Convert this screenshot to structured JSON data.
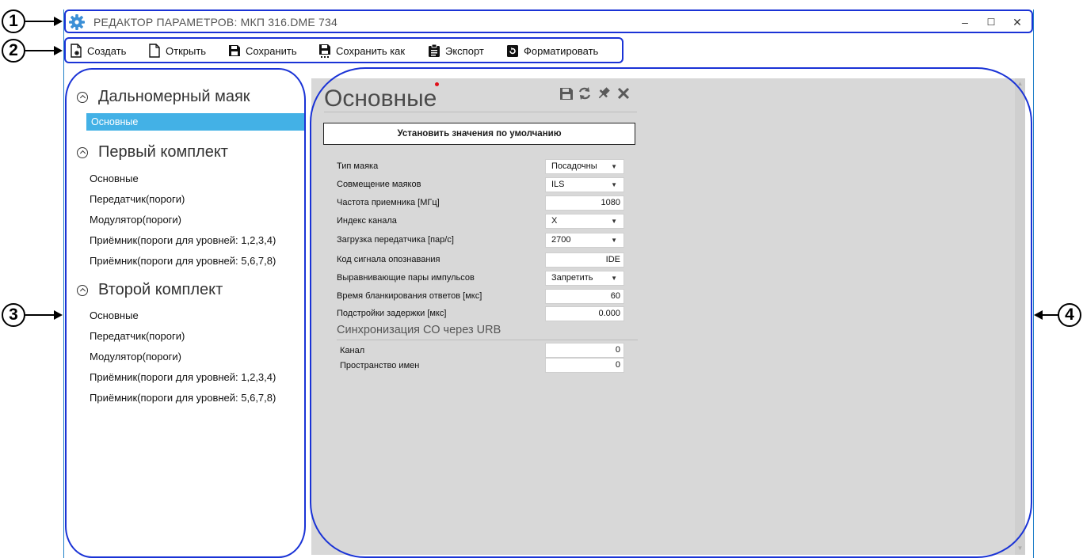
{
  "window": {
    "title": "РЕДАКТОР ПАРАМЕТРОВ: МКП 316.DME 734",
    "minimize": "–",
    "maximize": "☐",
    "close": "✕"
  },
  "toolbar": {
    "create": "Создать",
    "open": "Открыть",
    "save": "Сохранить",
    "save_as": "Сохранить как",
    "export": "Экспорт",
    "format": "Форматировать"
  },
  "nav": {
    "group1": {
      "title": "Дальномерный маяк",
      "items": [
        "Основные"
      ]
    },
    "group2": {
      "title": "Первый комплект",
      "items": [
        "Основные",
        "Передатчик(пороги)",
        "Модулятор(пороги)",
        "Приёмник(пороги для уровней: 1,2,3,4)",
        "Приёмник(пороги для уровней: 5,6,7,8)"
      ]
    },
    "group3": {
      "title": "Второй комплект",
      "items": [
        "Основные",
        "Передатчик(пороги)",
        "Модулятор(пороги)",
        "Приёмник(пороги для уровней: 1,2,3,4)",
        "Приёмник(пороги для уровней: 5,6,7,8)"
      ]
    },
    "selected_index": 0,
    "selected_color": "#43b1e6"
  },
  "panel": {
    "title": "Основные",
    "default_button": "Установить значения по умолчанию",
    "rows": [
      {
        "label": "Тип маяка",
        "value": "Посадочны",
        "type": "select"
      },
      {
        "label": "Совмещение маяков",
        "value": "ILS",
        "type": "select"
      },
      {
        "label": "Частота приемника  [МГц]",
        "value": "1080",
        "type": "input"
      },
      {
        "label": "Индекс канала",
        "value": "X",
        "type": "select"
      },
      {
        "label": "Загрузка передатчика  [пар/с]",
        "value": "2700",
        "type": "select"
      },
      {
        "label": "Код сигнала опознавания",
        "value": "IDE",
        "type": "input"
      },
      {
        "label": "Выравнивающие пары импульсов",
        "value": "Запретить",
        "type": "select"
      },
      {
        "label": "Время бланкирования ответов  [мкс]",
        "value": "60",
        "type": "input"
      },
      {
        "label": "Подстройки задержки  [мкс]",
        "value": "0.000",
        "type": "input"
      }
    ],
    "sync": {
      "title": "Синхронизация СО через URB",
      "rows": [
        {
          "label": "Канал",
          "value": "0"
        },
        {
          "label": "Пространство имен",
          "value": "0"
        }
      ]
    }
  },
  "callouts": [
    "1",
    "2",
    "3",
    "4"
  ],
  "colors": {
    "accent_blue": "#1a33d6",
    "title_icon": "#3b8fd6",
    "dirty_dot": "#e0101a",
    "panel_bg": "#d8d8d8"
  }
}
